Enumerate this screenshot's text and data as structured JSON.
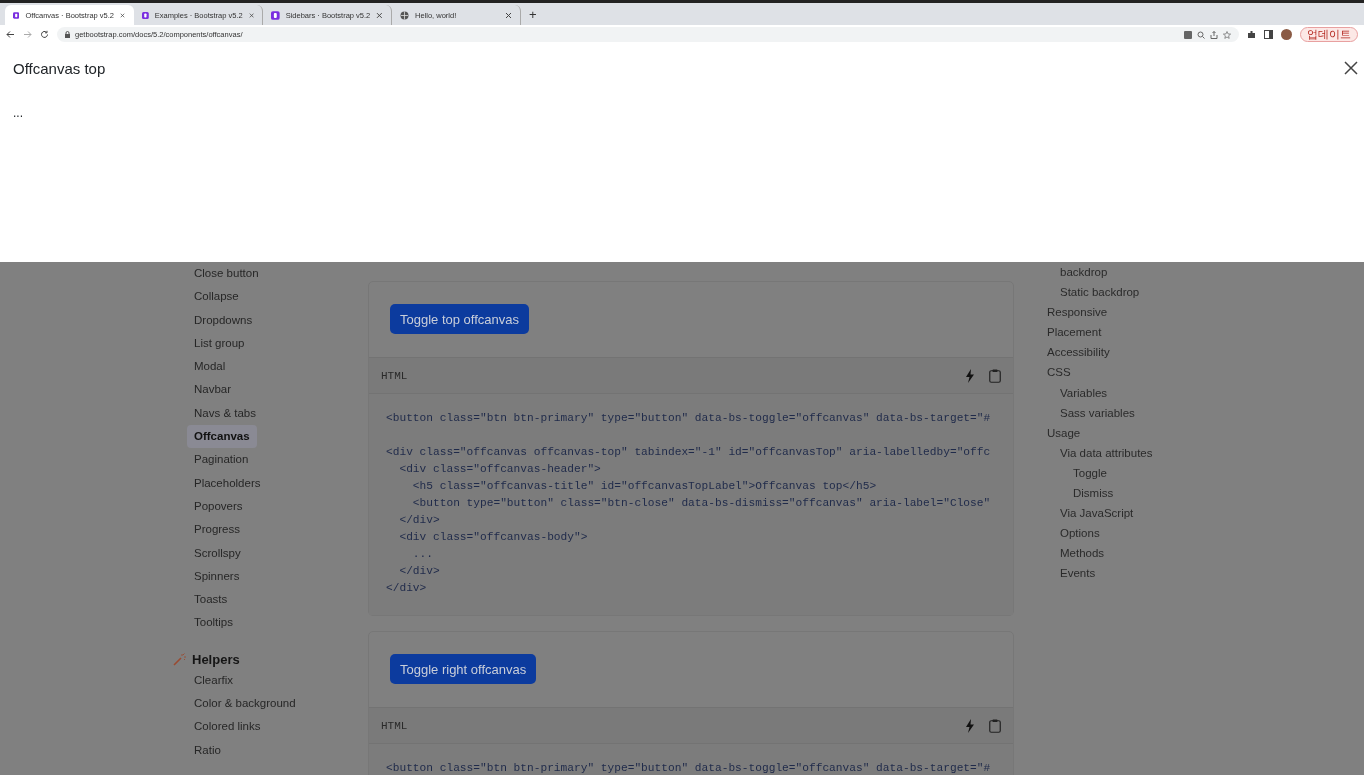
{
  "browser": {
    "tabs": [
      {
        "title": "Offcanvas · Bootstrap v5.2",
        "kind": "logo",
        "selected": true
      },
      {
        "title": "Examples · Bootstrap v5.2",
        "kind": "logo",
        "selected": false
      },
      {
        "title": "Sidebars · Bootstrap v5.2",
        "kind": "logo",
        "selected": false
      },
      {
        "title": "Hello, world!",
        "kind": "globe",
        "selected": false
      }
    ],
    "new_tab": "+",
    "url": "getbootstrap.com/docs/5.2/components/offcanvas/",
    "update_button": "업데이트"
  },
  "offcanvas": {
    "title": "Offcanvas top",
    "body": "..."
  },
  "sidebar": {
    "items": [
      {
        "label": "Close button",
        "selected": false
      },
      {
        "label": "Collapse",
        "selected": false
      },
      {
        "label": "Dropdowns",
        "selected": false
      },
      {
        "label": "List group",
        "selected": false
      },
      {
        "label": "Modal",
        "selected": false
      },
      {
        "label": "Navbar",
        "selected": false
      },
      {
        "label": "Navs & tabs",
        "selected": false
      },
      {
        "label": "Offcanvas",
        "selected": true
      },
      {
        "label": "Pagination",
        "selected": false
      },
      {
        "label": "Placeholders",
        "selected": false
      },
      {
        "label": "Popovers",
        "selected": false
      },
      {
        "label": "Progress",
        "selected": false
      },
      {
        "label": "Scrollspy",
        "selected": false
      },
      {
        "label": "Spinners",
        "selected": false
      },
      {
        "label": "Toasts",
        "selected": false
      },
      {
        "label": "Tooltips",
        "selected": false
      }
    ],
    "section": {
      "title": "Helpers",
      "items": [
        {
          "label": "Clearfix",
          "selected": false
        },
        {
          "label": "Color & background",
          "selected": false
        },
        {
          "label": "Colored links",
          "selected": false
        },
        {
          "label": "Ratio",
          "selected": false
        }
      ]
    }
  },
  "examples": [
    {
      "button": "Toggle top offcanvas",
      "language": "HTML",
      "code": "<button class=\"btn btn-primary\" type=\"button\" data-bs-toggle=\"offcanvas\" data-bs-target=\"#\n\n<div class=\"offcanvas offcanvas-top\" tabindex=\"-1\" id=\"offcanvasTop\" aria-labelledby=\"offc\n  <div class=\"offcanvas-header\">\n    <h5 class=\"offcanvas-title\" id=\"offcanvasTopLabel\">Offcanvas top</h5>\n    <button type=\"button\" class=\"btn-close\" data-bs-dismiss=\"offcanvas\" aria-label=\"Close\"\n  </div>\n  <div class=\"offcanvas-body\">\n    ...\n  </div>\n</div>"
    },
    {
      "button": "Toggle right offcanvas",
      "language": "HTML",
      "code": "<button class=\"btn btn-primary\" type=\"button\" data-bs-toggle=\"offcanvas\" data-bs-target=\"#"
    }
  ],
  "toc_continued": [
    {
      "label": "backdrop"
    },
    {
      "label": "Static backdrop"
    }
  ],
  "toc": [
    {
      "label": "Responsive"
    },
    {
      "label": "Placement"
    },
    {
      "label": "Accessibility"
    },
    {
      "label": "CSS",
      "children": [
        {
          "label": "Variables"
        },
        {
          "label": "Sass variables"
        }
      ]
    },
    {
      "label": "Usage",
      "children": [
        {
          "label": "Via data attributes",
          "children": [
            {
              "label": "Toggle"
            },
            {
              "label": "Dismiss"
            }
          ]
        },
        {
          "label": "Via JavaScript"
        },
        {
          "label": "Options"
        },
        {
          "label": "Methods"
        },
        {
          "label": "Events"
        }
      ]
    }
  ]
}
